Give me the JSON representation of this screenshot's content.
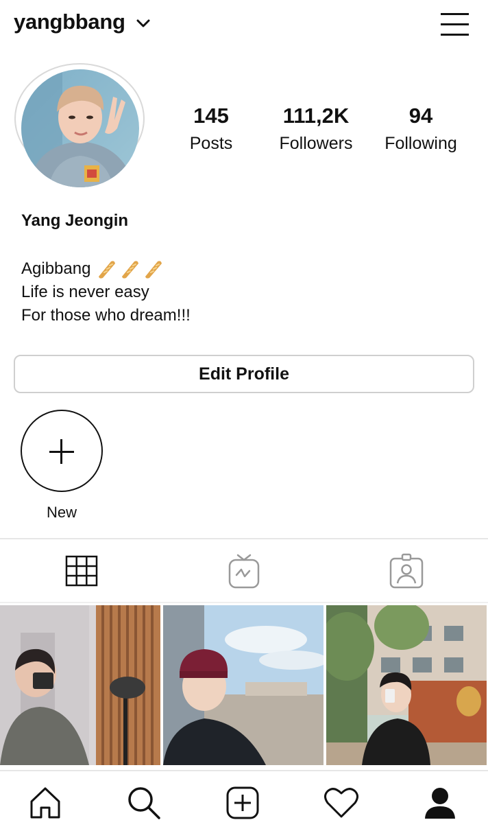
{
  "header": {
    "username": "yangbbang",
    "switch_icon": "chevron-down-icon",
    "menu_icon": "hamburger-menu-icon"
  },
  "stats": [
    {
      "value": "145",
      "label": "Posts"
    },
    {
      "value": "111,2K",
      "label": "Followers"
    },
    {
      "value": "94",
      "label": "Following"
    }
  ],
  "profile": {
    "full_name": "Yang Jeongin",
    "bio": [
      "Agibbang",
      "Life is never easy",
      "For those who dream!!!"
    ],
    "bio_emoji": "baguette-bread-emoji",
    "bio_emoji_count": 3
  },
  "edit_profile_label": "Edit Profile",
  "highlight": {
    "label": "New",
    "icon": "plus-icon"
  },
  "tabs": [
    {
      "name": "posts-grid",
      "icon": "grid-icon",
      "active": true
    },
    {
      "name": "igtv",
      "icon": "igtv-icon",
      "active": false
    },
    {
      "name": "tagged",
      "icon": "tagged-person-icon",
      "active": false
    }
  ],
  "bottom_nav": [
    "home-icon",
    "search-icon",
    "new-post-icon",
    "activity-heart-icon",
    "profile-icon"
  ],
  "colors": {
    "text": "#111111",
    "border": "#cfcfcf",
    "divider": "#e6e6e6",
    "background": "#ffffff"
  }
}
